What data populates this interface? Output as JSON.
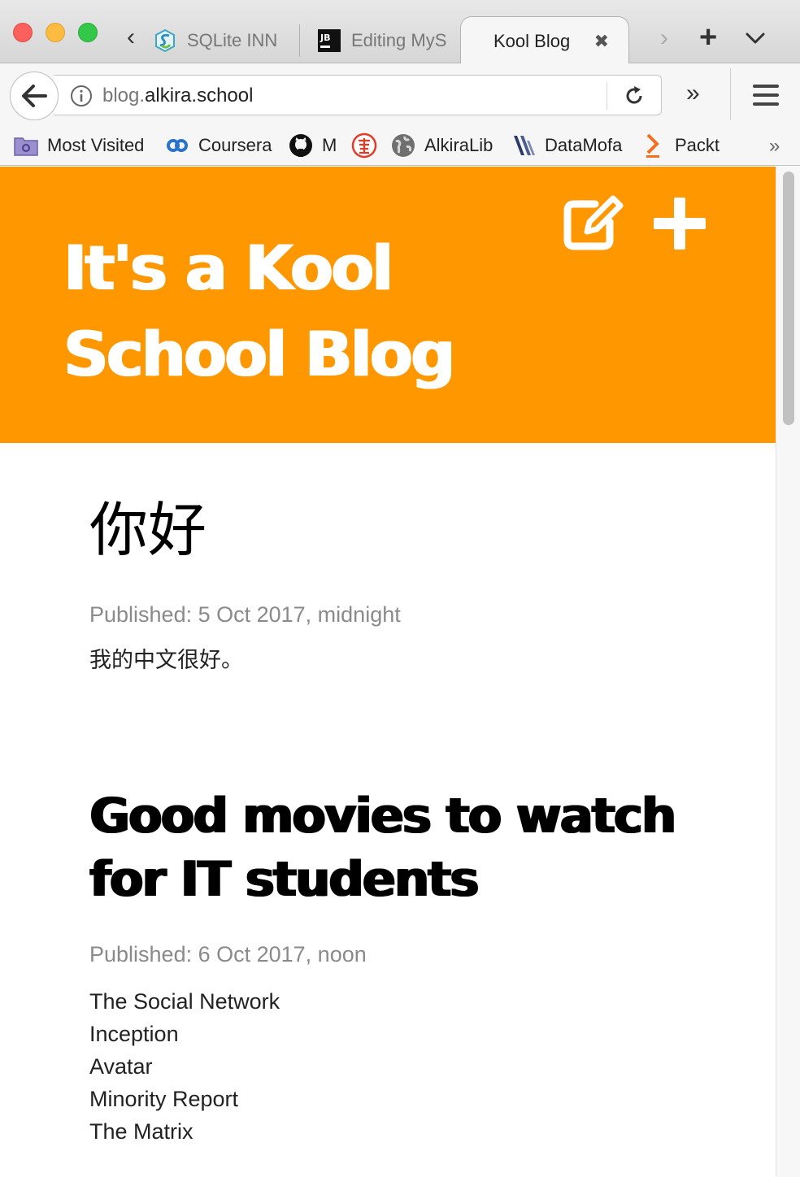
{
  "browser": {
    "tabs": [
      {
        "label": "SQLite INN",
        "active": false,
        "icon": "sqlite-icon"
      },
      {
        "label": "Editing MyS",
        "active": false,
        "icon": "jetbrains-icon"
      },
      {
        "label": "Kool Blog",
        "active": true,
        "close_glyph": "✖"
      }
    ],
    "url": {
      "dim_part": "blog.",
      "main_part": "alkira.school"
    },
    "bookmarks": [
      {
        "label": "Most Visited",
        "icon": "folder-icon"
      },
      {
        "label": "Coursera",
        "icon": "coursera-icon"
      },
      {
        "label": "M",
        "icon": "github-icon"
      },
      {
        "label": "",
        "icon": "seal-icon"
      },
      {
        "label": "AlkiraLib",
        "icon": "globe-icon"
      },
      {
        "label": "DataMofa",
        "icon": "datamofa-icon"
      },
      {
        "label": "Packt",
        "icon": "packt-icon"
      }
    ]
  },
  "blog": {
    "header_line1": "It's a Kool",
    "header_line2": "School Blog",
    "accent_color": "#ff9800",
    "actions": [
      {
        "name": "edit",
        "icon": "edit-icon"
      },
      {
        "name": "add",
        "icon": "plus-icon"
      }
    ],
    "posts": [
      {
        "title": "你好",
        "published": "Published: 5 Oct 2017, midnight",
        "body": [
          "我的中文很好。"
        ]
      },
      {
        "title_line1": "Good movies to watch",
        "title_line2": "for IT students",
        "published": "Published: 6 Oct 2017, noon",
        "body": [
          "The Social Network",
          "Inception",
          "Avatar",
          "Minority Report",
          "The Matrix"
        ]
      }
    ]
  }
}
